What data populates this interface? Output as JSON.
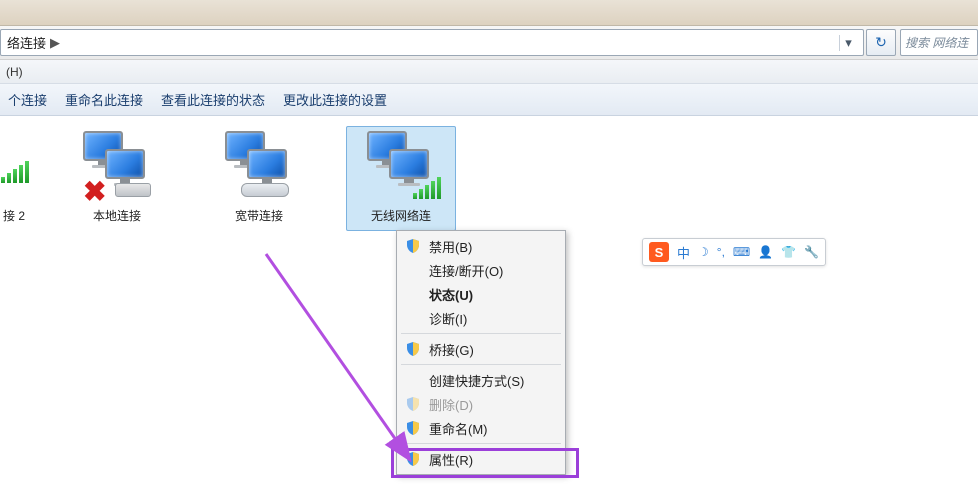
{
  "address": {
    "crumb": "络连接",
    "arrow": "▶"
  },
  "search": {
    "placeholder": "搜索 网络连"
  },
  "menubar": {
    "help": "(H)"
  },
  "toolbar": {
    "items": [
      "个连接",
      "重命名此连接",
      "查看此连接的状态",
      "更改此连接的设置"
    ]
  },
  "connections": [
    {
      "label": "接 2",
      "variant": "signal-cut"
    },
    {
      "label": "本地连接",
      "variant": "x-cable"
    },
    {
      "label": "宽带连接",
      "variant": "modem"
    },
    {
      "label": "无线网络连",
      "variant": "signal",
      "selected": true
    }
  ],
  "context_menu": [
    {
      "label": "禁用(B)",
      "shield": true
    },
    {
      "label": "连接/断开(O)"
    },
    {
      "label": "状态(U)",
      "bold": true
    },
    {
      "label": "诊断(I)"
    },
    {
      "sep": true
    },
    {
      "label": "桥接(G)",
      "shield": true
    },
    {
      "sep": true
    },
    {
      "label": "创建快捷方式(S)"
    },
    {
      "label": "删除(D)",
      "shield": true,
      "disabled": true
    },
    {
      "label": "重命名(M)",
      "shield": true
    },
    {
      "sep": true
    },
    {
      "label": "属性(R)",
      "shield": true
    }
  ],
  "ime": {
    "logo": "S",
    "lang": "中",
    "moon": "☽",
    "punct": "°,",
    "keyboard": "⌨",
    "person": "👤",
    "shirt": "👕",
    "wrench": "🔧"
  }
}
